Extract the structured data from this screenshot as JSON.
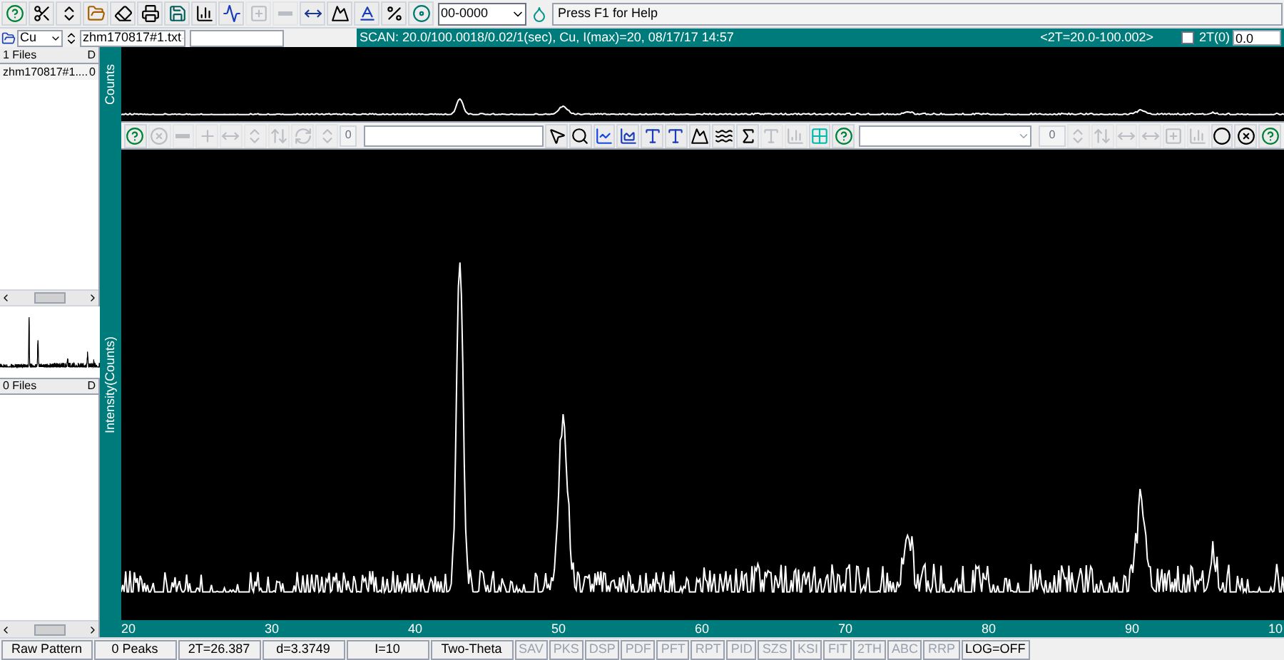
{
  "toolbar": {
    "buttons": [
      {
        "disabled": false
      },
      {
        "disabled": false
      },
      {
        "disabled": false
      },
      {
        "disabled": false
      },
      {
        "disabled": false
      },
      {
        "disabled": false
      },
      {
        "disabled": false
      },
      {
        "disabled": false
      },
      {
        "disabled": false
      },
      {
        "disabled": true
      },
      {
        "disabled": true
      },
      {
        "disabled": false
      },
      {
        "disabled": false
      },
      {
        "disabled": false
      },
      {
        "disabled": false
      },
      {
        "disabled": false
      }
    ],
    "pattern_combo": {
      "value": "00-0000"
    },
    "help_field": {
      "value": "Press F1 for Help"
    }
  },
  "file_bar": {
    "element": "Cu",
    "file": "zhm170817#1.txt"
  },
  "scan_bar": {
    "info": "SCAN: 20.0/100.0018/0.02/1(sec), Cu, I(max)=20, 08/17/17 14:57",
    "range": "<2T=20.0-100.002>",
    "zero": {
      "label": "2T(0)",
      "checked": false,
      "value": "0.0"
    }
  },
  "file_panel": {
    "header": "1 Files",
    "column_2": "D",
    "items": [
      {
        "name": "zhm170817#1....",
        "column_2": "0"
      }
    ]
  },
  "overlay_panel": {
    "header": "0 Files",
    "column_2": "D"
  },
  "plot": {
    "overview_ylabel": "Counts",
    "ylabel": "Intensity(Counts)",
    "xticks": [
      "20",
      "30",
      "40",
      "50",
      "60",
      "70",
      "80",
      "90",
      "10"
    ]
  },
  "plot_toolbar": {
    "left_buttons": [
      {
        "disabled": false
      },
      {
        "disabled": true
      },
      {
        "disabled": true
      },
      {
        "disabled": true
      },
      {
        "disabled": true
      },
      {
        "disabled": true
      },
      {
        "disabled": true
      },
      {
        "disabled": true
      },
      {
        "disabled": true
      }
    ],
    "left_value": "0",
    "middle_buttons": [
      {
        "disabled": false
      },
      {
        "disabled": false
      },
      {
        "disabled": false
      },
      {
        "disabled": false
      },
      {
        "disabled": false
      },
      {
        "disabled": false
      },
      {
        "disabled": false
      },
      {
        "disabled": false
      },
      {
        "disabled": false
      },
      {
        "disabled": true
      },
      {
        "disabled": true
      },
      {
        "disabled": false
      },
      {
        "disabled": false
      }
    ],
    "right_value": "0",
    "right_buttons": [
      {
        "disabled": true
      },
      {
        "disabled": true
      },
      {
        "disabled": true
      },
      {
        "disabled": true
      },
      {
        "disabled": true
      },
      {
        "disabled": true
      },
      {
        "disabled": false
      },
      {
        "disabled": false
      },
      {
        "disabled": false
      }
    ]
  },
  "status_bar": [
    {
      "text": "Raw Pattern",
      "disabled": false
    },
    {
      "text": "0 Peaks",
      "disabled": false
    },
    {
      "text": "2T=26.387",
      "disabled": false
    },
    {
      "text": "d=3.3749",
      "disabled": false
    },
    {
      "text": "I=10",
      "disabled": false
    },
    {
      "text": "Two-Theta",
      "disabled": false
    },
    {
      "text": "SAV",
      "disabled": true
    },
    {
      "text": "PKS",
      "disabled": true
    },
    {
      "text": "DSP",
      "disabled": true
    },
    {
      "text": "PDF",
      "disabled": true
    },
    {
      "text": "PFT",
      "disabled": true
    },
    {
      "text": "RPT",
      "disabled": true
    },
    {
      "text": "PID",
      "disabled": true
    },
    {
      "text": "SZS",
      "disabled": true
    },
    {
      "text": "KSI",
      "disabled": true
    },
    {
      "text": "FIT",
      "disabled": true
    },
    {
      "text": "2TH",
      "disabled": true
    },
    {
      "text": "ABC",
      "disabled": true
    },
    {
      "text": "RRP",
      "disabled": true
    },
    {
      "text": "LOG=OFF",
      "disabled": false
    }
  ]
}
